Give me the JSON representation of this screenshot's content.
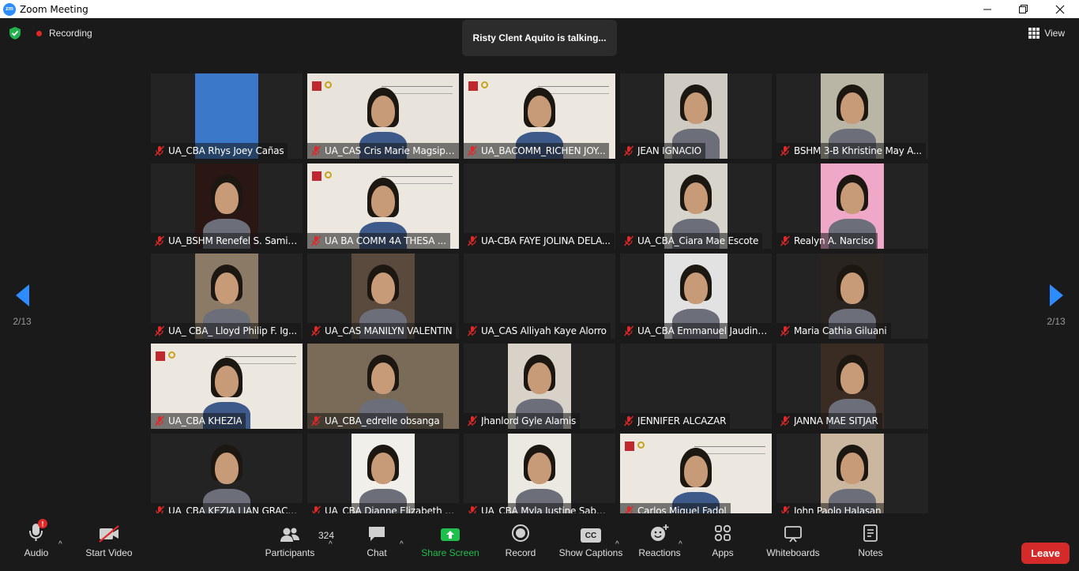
{
  "window": {
    "title": "Zoom Meeting",
    "app_logo": "zm"
  },
  "topbar": {
    "recording_label": "Recording",
    "talking_text": "Risty Clent Aquito is talking...",
    "view_label": "View"
  },
  "pager": {
    "left": "2/13",
    "right": "2/13"
  },
  "participants": [
    {
      "name": "UA_CBA Rhys Joey Cañas"
    },
    {
      "name": "UA_CAS Cris Marie Magsipoc"
    },
    {
      "name": "UA_BACOMM_RICHEN JOY..."
    },
    {
      "name": "JEAN IGNACIO"
    },
    {
      "name": "BSHM 3-B Khristine May A..."
    },
    {
      "name": "UA_BSHM Renefel S. Samillano"
    },
    {
      "name": "UA BA COMM 4A THESA ..."
    },
    {
      "name": "UA-CBA FAYE JOLINA DELA..."
    },
    {
      "name": "UA_CBA_Ciara Mae Escote"
    },
    {
      "name": "Realyn A. Narciso"
    },
    {
      "name": "UA_ CBA_ Lloyd Philip F. Ig..."
    },
    {
      "name": "UA_CAS MANILYN VALENTIN"
    },
    {
      "name": "UA_CAS Alliyah Kaye Alorro"
    },
    {
      "name": "UA_CBA Emmanuel Jaudine..."
    },
    {
      "name": "Maria Cathia Giluani"
    },
    {
      "name": "UA_CBA KHEZIA"
    },
    {
      "name": "UA_CBA_edrelle obsanga"
    },
    {
      "name": "Jhanlord Gyle Alamis"
    },
    {
      "name": "JENNIFER ALCAZAR"
    },
    {
      "name": "JANNA MAE SITJAR"
    },
    {
      "name": "UA_CBA KEZIA LIAN GRACE..."
    },
    {
      "name": "UA_CBA Dianne Elizabeth B..."
    },
    {
      "name": "UA_CBA Myla Justine Sabuya"
    },
    {
      "name": "Carlos Miguel Fadol"
    },
    {
      "name": "John Paolo Halasan"
    }
  ],
  "toolbar": {
    "audio": "Audio",
    "audio_badge": "!",
    "start_video": "Start Video",
    "participants": "Participants",
    "participants_count": "324",
    "chat": "Chat",
    "share_screen": "Share Screen",
    "record": "Record",
    "captions": "Show Captions",
    "captions_icon_text": "CC",
    "reactions": "Reactions",
    "apps": "Apps",
    "whiteboards": "Whiteboards",
    "notes": "Notes",
    "leave": "Leave"
  },
  "colors": {
    "accent": "#2d8cff",
    "share_green": "#1fbf4d",
    "leave_red": "#d52a2a",
    "mute_red": "#e02828"
  }
}
